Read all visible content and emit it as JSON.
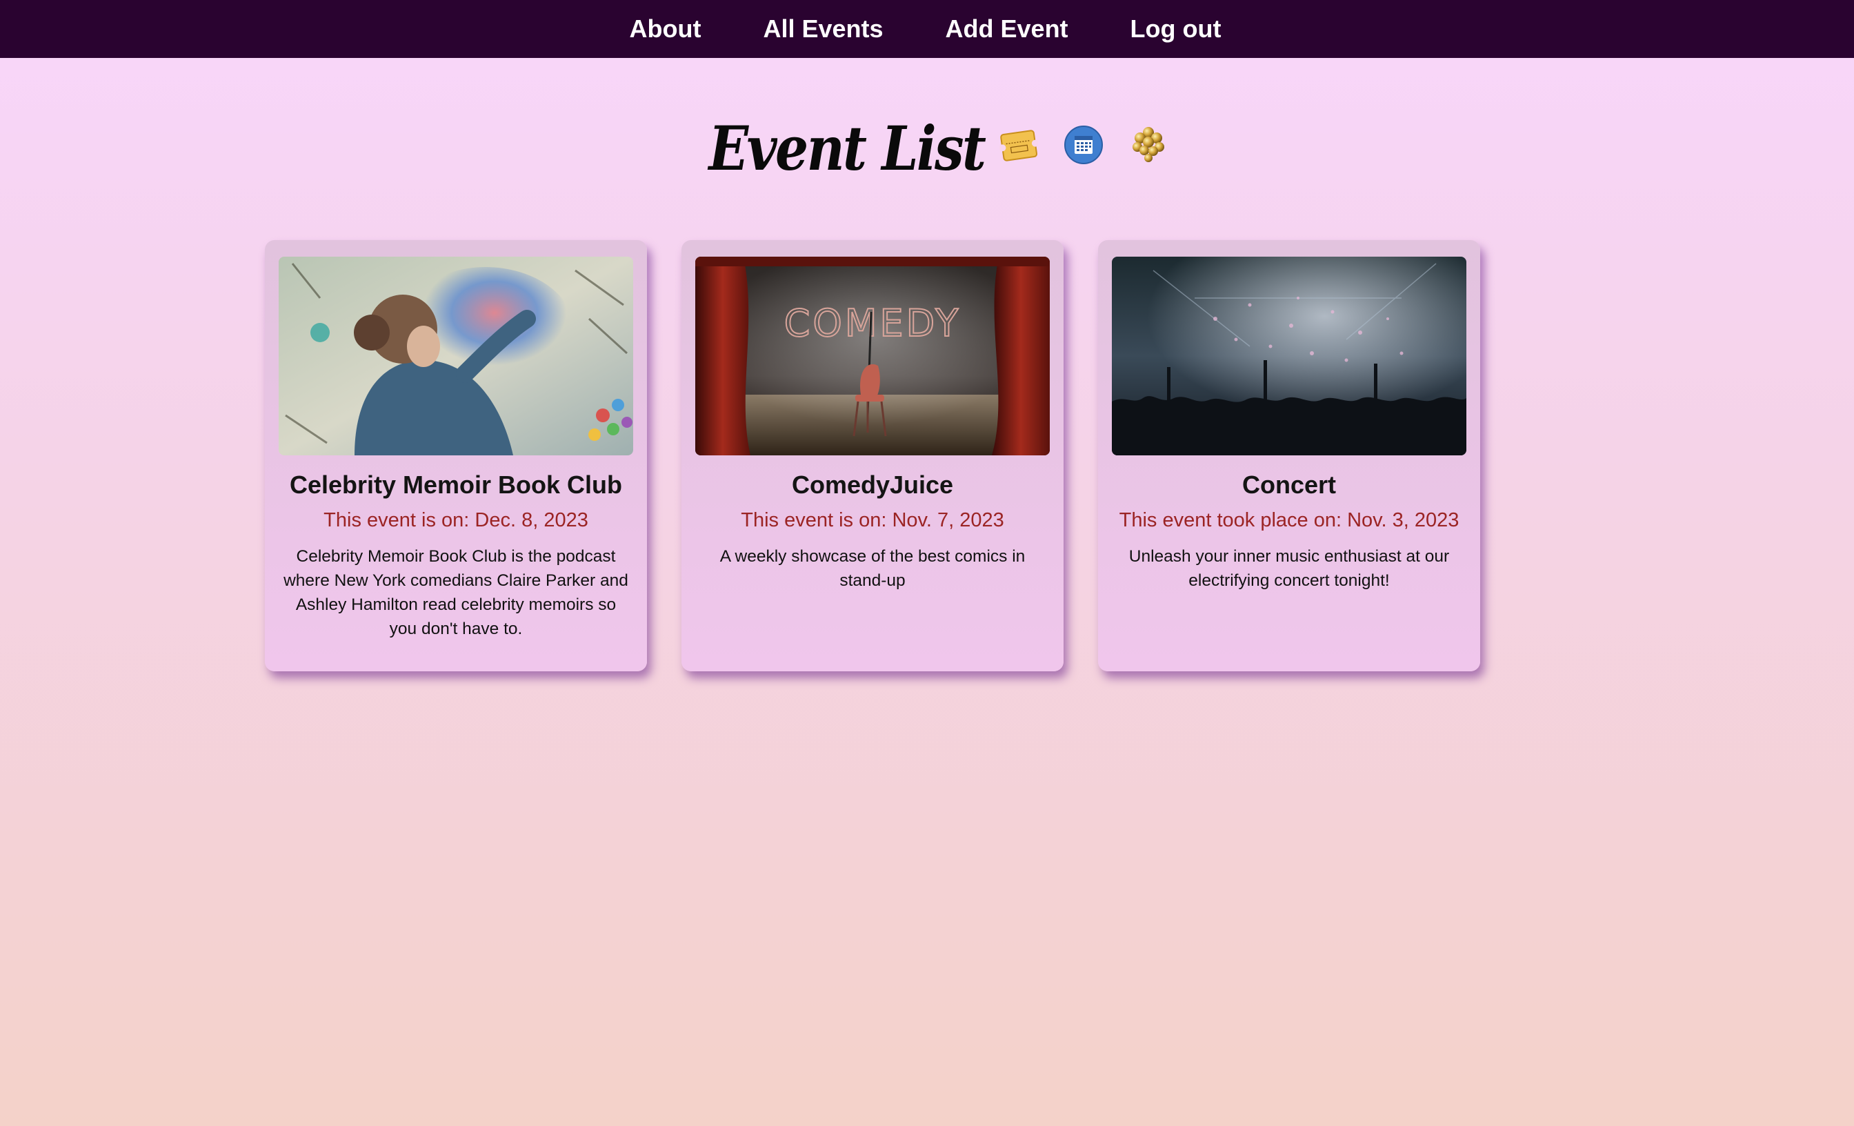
{
  "nav": {
    "items": [
      {
        "label": "About"
      },
      {
        "label": "All Events"
      },
      {
        "label": "Add Event"
      },
      {
        "label": "Log out"
      }
    ]
  },
  "header": {
    "title": "Event List",
    "icons": [
      "ticket-icon",
      "calendar-icon",
      "balloons-icon"
    ]
  },
  "events": [
    {
      "title": "Celebrity Memoir Book Club",
      "date_text": "This event is on: Dec. 8, 2023",
      "description": "Celebrity Memoir Book Club is the podcast where New York comedians Claire Parker and Ashley Hamilton read celebrity memoirs so you don't have to.",
      "image": "artist-painting-image"
    },
    {
      "title": "ComedyJuice",
      "date_text": "This event is on: Nov. 7, 2023",
      "description": "A weekly showcase of the best comics in stand-up",
      "image": "comedy-stage-image",
      "image_text": "COMEDY"
    },
    {
      "title": "Concert",
      "date_text": "This event took place on: Nov. 3, 2023",
      "description": "Unleash your inner music enthusiast at our electrifying concert tonight!",
      "image": "concert-crowd-image"
    }
  ],
  "colors": {
    "navbar": "#2a0330",
    "date_text": "#9b2424",
    "background_top": "#f8d6fb",
    "background_bottom": "#f4d2c9"
  }
}
